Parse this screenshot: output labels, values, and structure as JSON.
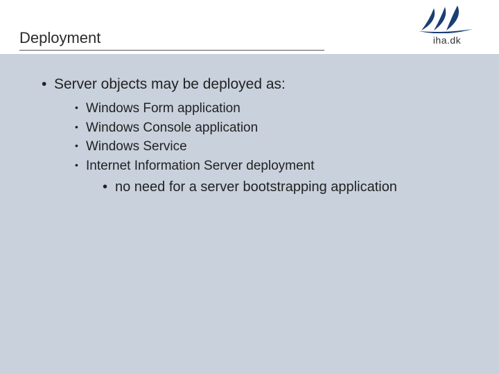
{
  "header": {
    "title": "Deployment",
    "logo_text": "iha.dk"
  },
  "slide": {
    "main_point": "Server objects may be deployed as:",
    "items": [
      "Windows Form application",
      "Windows Console application",
      "Windows Service",
      "Internet Information Server deployment"
    ],
    "sub_point": "no need for a server bootstrapping application"
  }
}
